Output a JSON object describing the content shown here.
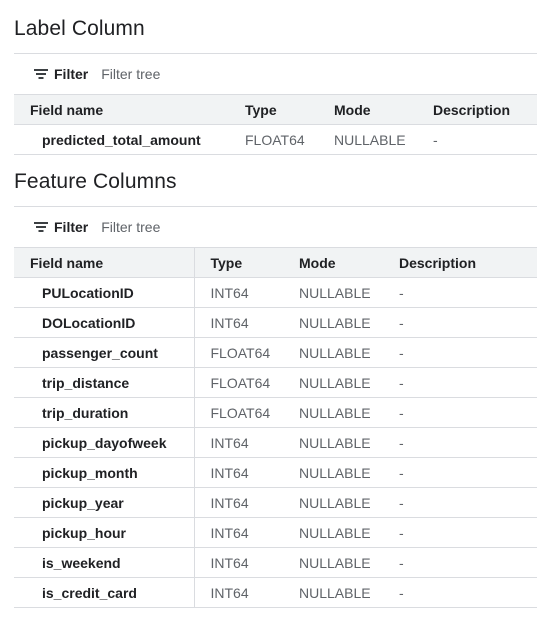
{
  "label_section": {
    "title": "Label Column",
    "filter": {
      "label": "Filter",
      "placeholder": "Filter tree"
    },
    "columns": [
      "Field name",
      "Type",
      "Mode",
      "Description"
    ],
    "rows": [
      {
        "name": "predicted_total_amount",
        "type": "FLOAT64",
        "mode": "NULLABLE",
        "description": "-"
      }
    ]
  },
  "feature_section": {
    "title": "Feature Columns",
    "filter": {
      "label": "Filter",
      "placeholder": "Filter tree"
    },
    "columns": [
      "Field name",
      "Type",
      "Mode",
      "Description"
    ],
    "rows": [
      {
        "name": "PULocationID",
        "type": "INT64",
        "mode": "NULLABLE",
        "description": "-"
      },
      {
        "name": "DOLocationID",
        "type": "INT64",
        "mode": "NULLABLE",
        "description": "-"
      },
      {
        "name": "passenger_count",
        "type": "FLOAT64",
        "mode": "NULLABLE",
        "description": "-"
      },
      {
        "name": "trip_distance",
        "type": "FLOAT64",
        "mode": "NULLABLE",
        "description": "-"
      },
      {
        "name": "trip_duration",
        "type": "FLOAT64",
        "mode": "NULLABLE",
        "description": "-"
      },
      {
        "name": "pickup_dayofweek",
        "type": "INT64",
        "mode": "NULLABLE",
        "description": "-"
      },
      {
        "name": "pickup_month",
        "type": "INT64",
        "mode": "NULLABLE",
        "description": "-"
      },
      {
        "name": "pickup_year",
        "type": "INT64",
        "mode": "NULLABLE",
        "description": "-"
      },
      {
        "name": "pickup_hour",
        "type": "INT64",
        "mode": "NULLABLE",
        "description": "-"
      },
      {
        "name": "is_weekend",
        "type": "INT64",
        "mode": "NULLABLE",
        "description": "-"
      },
      {
        "name": "is_credit_card",
        "type": "INT64",
        "mode": "NULLABLE",
        "description": "-"
      }
    ]
  },
  "icons": {
    "filter": "filter-list-icon"
  },
  "colors": {
    "header_bg": "#f1f3f4",
    "border": "#dadce0",
    "muted_text": "#5f6368",
    "text": "#202124"
  }
}
